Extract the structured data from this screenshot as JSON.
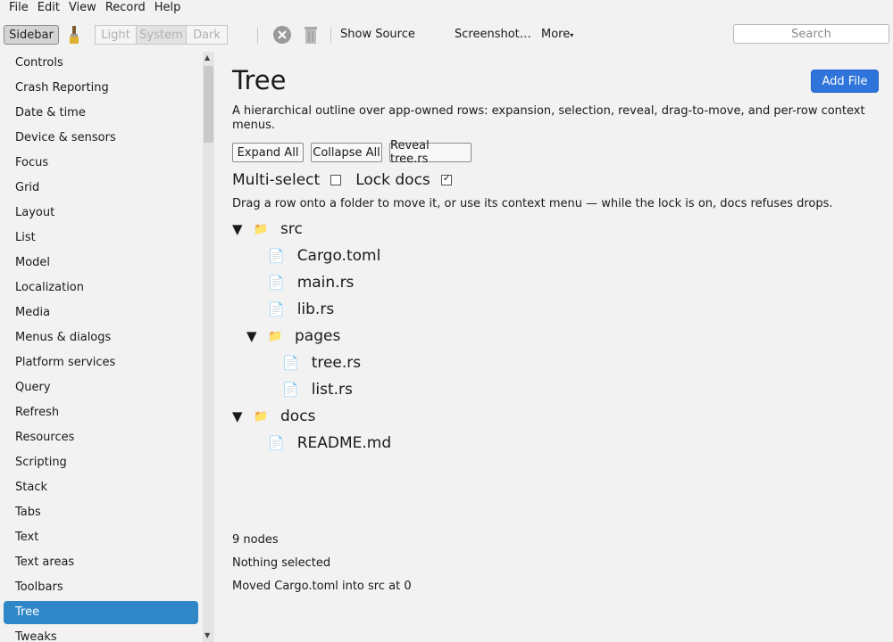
{
  "menubar": {
    "items": [
      "File",
      "Edit",
      "View",
      "Record",
      "Help"
    ]
  },
  "toolbar": {
    "sidebar_label": "Sidebar",
    "brush_icon": "paintbrush-icon",
    "theme_segments": [
      "Light",
      "System",
      "Dark"
    ],
    "theme_selected": "System",
    "stop_icon": "stop-icon",
    "trash_icon": "trash-icon",
    "show_source": "Show Source",
    "screenshot": "Screenshot…",
    "more": "More",
    "search_placeholder": "Search"
  },
  "sidebar": {
    "items": [
      "Controls",
      "Crash Reporting",
      "Date & time",
      "Device & sensors",
      "Focus",
      "Grid",
      "Layout",
      "List",
      "Model",
      "Localization",
      "Media",
      "Menus & dialogs",
      "Platform services",
      "Query",
      "Refresh",
      "Resources",
      "Scripting",
      "Stack",
      "Tabs",
      "Text",
      "Text areas",
      "Toolbars",
      "Tree",
      "Tweaks"
    ],
    "selected": "Tree"
  },
  "main": {
    "title": "Tree",
    "add_file": "Add File",
    "description": "A hierarchical outline over app-owned rows: expansion, selection, reveal, drag-to-move, and per-row context menus.",
    "buttons": {
      "expand_all": "Expand All",
      "collapse_all": "Collapse All",
      "reveal": "Reveal tree.rs"
    },
    "multi_select": {
      "label": "Multi-select",
      "checked": false
    },
    "lock_docs": {
      "label": "Lock docs",
      "checked": true
    },
    "hint": "Drag a row onto a folder to move it, or use its context menu — while the lock is on, docs refuses drops.",
    "tree": [
      {
        "label": "src",
        "kind": "folder",
        "depth": 0,
        "expanded": true
      },
      {
        "label": "Cargo.toml",
        "kind": "file",
        "depth": 1
      },
      {
        "label": "main.rs",
        "kind": "file",
        "depth": 1
      },
      {
        "label": "lib.rs",
        "kind": "file",
        "depth": 1
      },
      {
        "label": "pages",
        "kind": "folder",
        "depth": 1,
        "expanded": true
      },
      {
        "label": "tree.rs",
        "kind": "file",
        "depth": 2
      },
      {
        "label": "list.rs",
        "kind": "file",
        "depth": 2
      },
      {
        "label": "docs",
        "kind": "folder",
        "depth": 0,
        "expanded": true
      },
      {
        "label": "README.md",
        "kind": "file",
        "depth": 1
      }
    ],
    "status": {
      "count": "9 nodes",
      "selection": "Nothing selected",
      "last_action": "Moved Cargo.toml into src at 0"
    }
  }
}
